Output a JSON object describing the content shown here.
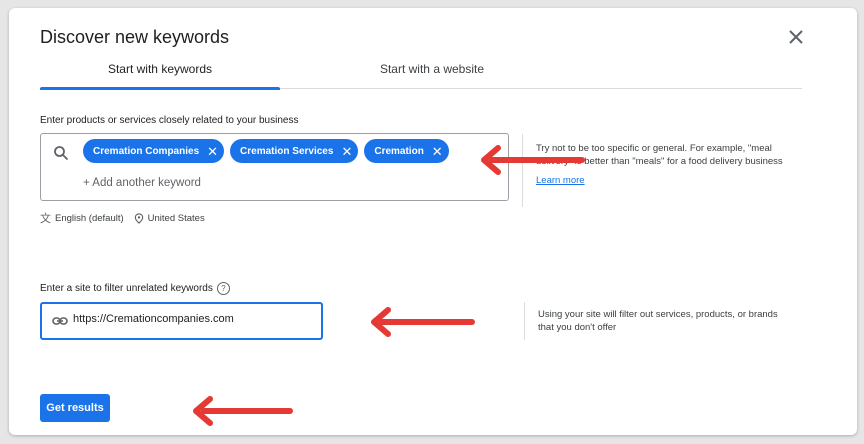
{
  "dialog": {
    "title": "Discover new keywords",
    "tabs": [
      {
        "label": "Start with keywords",
        "active": true
      },
      {
        "label": "Start with a website",
        "active": false
      }
    ]
  },
  "keywords_section": {
    "label": "Enter products or services closely related to your business",
    "chips": [
      "Cremation Companies",
      "Cremation Services",
      "Cremation"
    ],
    "add_placeholder": "+ Add another keyword",
    "language": "English (default)",
    "location": "United States",
    "help_text": "Try not to be too specific or general. For example, \"meal delivery\" is better than \"meals\" for a food delivery business",
    "learn_more": "Learn more"
  },
  "site_section": {
    "label": "Enter a site to filter unrelated keywords",
    "help_icon": "?",
    "value": "https://Cremationcompanies.com",
    "help_text": "Using your site will filter out services, products, or brands that you don't offer"
  },
  "actions": {
    "get_results": "Get results"
  },
  "colors": {
    "accent": "#1a73e8",
    "annotation_arrow": "#e53935"
  },
  "icons": {
    "close": "close-icon",
    "search": "search-icon",
    "translate": "translate-icon",
    "location": "location-pin-icon",
    "link": "link-icon"
  }
}
